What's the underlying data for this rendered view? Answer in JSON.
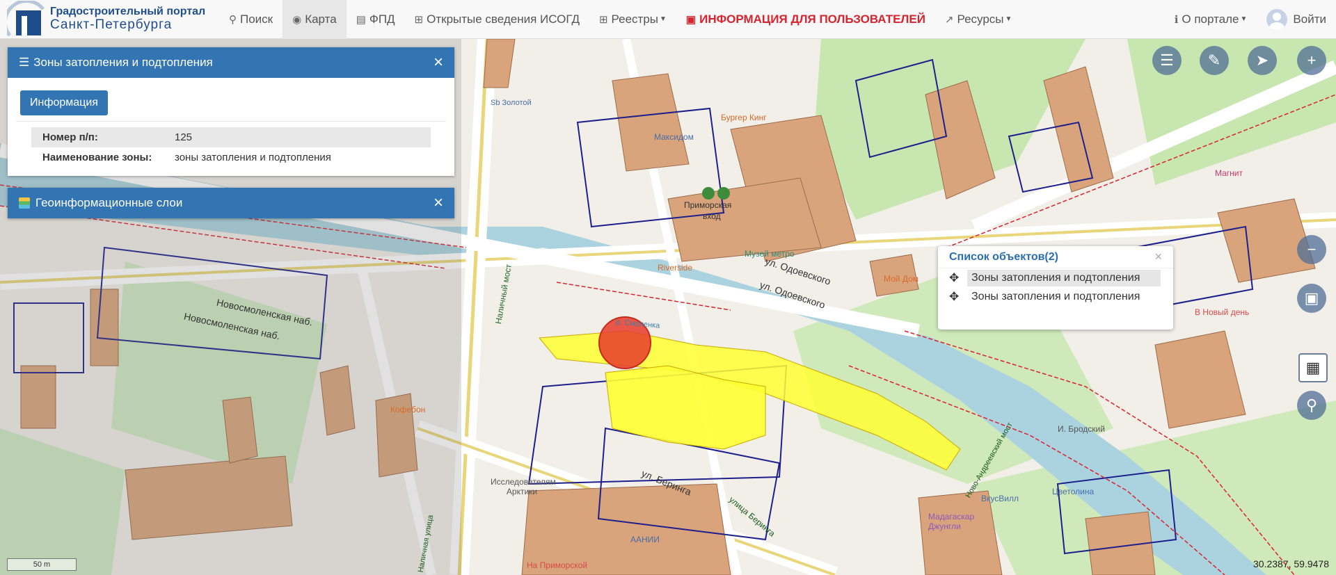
{
  "brand": {
    "line1": "Градостроительный портал",
    "line2": "Санкт-Петербурга"
  },
  "nav": {
    "search": "Поиск",
    "map": "Карта",
    "fpd": "ФПД",
    "isogd": "Открытые сведения ИСОГД",
    "registries": "Реестры",
    "user_info": "ИНФОРМАЦИЯ ДЛЯ ПОЛЬЗОВАТЕЛЕЙ",
    "resources": "Ресурсы",
    "about": "О портале",
    "login": "Войти"
  },
  "flood_panel": {
    "title": "Зоны затопления и подтопления",
    "info_button": "Информация",
    "rows": [
      {
        "key": "Номер п/п:",
        "value": "125"
      },
      {
        "key": "Наименование зоны:",
        "value": "зоны затопления и подтопления"
      }
    ]
  },
  "layers_panel": {
    "title": "Геоинформационные слои"
  },
  "object_list": {
    "title": "Список объектов(2)",
    "items": [
      "Зоны затопления и подтопления",
      "Зоны затопления и подтопления"
    ]
  },
  "map_labels": {
    "golden": "Sb Золотой",
    "maxidom": "Максидом",
    "burger": "Бургер Кинг",
    "primorskaya": "Приморская",
    "vhod": "вход",
    "metro_museum": "Музей метро",
    "riverside": "Riverside",
    "odoevskogo1": "ул. Одоевского",
    "odoevskogo2": "ул. Одоевского",
    "smolenka": "р. Смоленка",
    "novosmol1": "Новосмоленская наб.",
    "novosmol2": "Новосмоленская наб.",
    "nalichny": "Наличный мост",
    "bering1": "ул. Беринга",
    "bering2": "улица Беринга",
    "arktika": "Исследователям Арктики",
    "aanii": "ААНИИ",
    "kofebon": "Кофебон",
    "vkusvill": "ВкусВилл",
    "tsvetolina": "Цветолина",
    "madagascar": "Мадагаскар Джунгли",
    "brodsky": "И. Бродский",
    "magnit": "Магнит",
    "moy_dom": "Мой Дом",
    "novy_den": "В Новый день",
    "na_primorskoy": "На Приморской",
    "andreevsky": "Ново-Андреевский мост",
    "nalichnaya": "Наличная улица"
  },
  "scale_label": "50 m",
  "coords": "30.2387, 59.9478",
  "colors": {
    "header_blue": "#3375b3",
    "river": "#aad3df",
    "flood_zone": "#ffff33",
    "building": "#d9a47c",
    "park": "#c8e6b0",
    "parcel_line": "#1c1f8c",
    "red_line": "#d9232e"
  },
  "icons": {
    "search": "search-icon",
    "map": "globe-icon",
    "fpd": "map-icon",
    "isogd": "plus-square-icon",
    "registries": "table-icon",
    "info": "comments-icon",
    "resources": "external-link-icon",
    "about": "info-icon"
  }
}
